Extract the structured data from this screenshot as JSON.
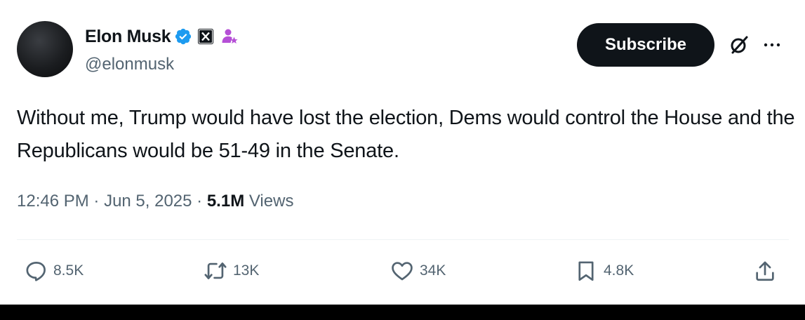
{
  "author": {
    "name": "Elon Musk",
    "handle": "@elonmusk"
  },
  "header": {
    "subscribe_label": "Subscribe"
  },
  "tweet": {
    "text": "Without me, Trump would have lost the election, Dems would control the House and the Republicans would be 51-49 in the Senate.",
    "time": "12:46 PM",
    "date": "Jun 5, 2025",
    "views_count": "5.1M",
    "views_label": "Views"
  },
  "actions": {
    "replies": "8.5K",
    "reposts": "13K",
    "likes": "34K",
    "bookmarks": "4.8K"
  },
  "icons": {
    "verified": "verified-badge-icon",
    "affiliate": "x-affiliate-icon",
    "badge": "person-star-icon",
    "grok": "grok-icon",
    "more": "more-icon",
    "reply": "reply-icon",
    "repost": "repost-icon",
    "like": "heart-icon",
    "bookmark": "bookmark-icon",
    "share": "share-icon"
  },
  "colors": {
    "text": "#0f1419",
    "secondary": "#536471",
    "verified": "#1d9bf0",
    "badge": "#b54fd6",
    "button_bg": "#0f1419"
  }
}
